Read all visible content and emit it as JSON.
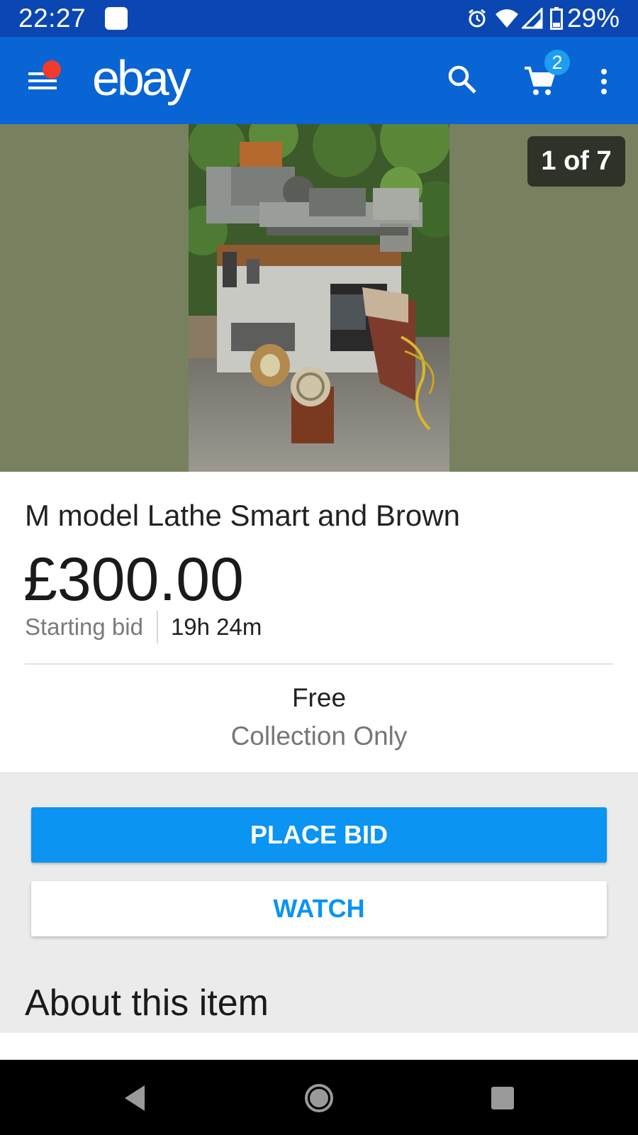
{
  "status_bar": {
    "time": "22:27",
    "battery_percent": "29%",
    "icons": [
      "notification-icon",
      "alarm-icon",
      "wifi-icon",
      "signal-icon",
      "battery-icon"
    ]
  },
  "app_bar": {
    "logo": "ebay",
    "cart_count": "2",
    "menu_has_notification": true,
    "icons": [
      "menu-icon",
      "search-icon",
      "cart-icon",
      "more-vert-icon"
    ]
  },
  "gallery": {
    "counter": "1 of 7",
    "photo": "lathe-photo"
  },
  "listing": {
    "title": "M model Lathe Smart and Brown",
    "price": "£300.00",
    "bid_label": "Starting bid",
    "time_left": "19h 24m",
    "shipping_cost": "Free",
    "shipping_method": "Collection Only"
  },
  "actions": {
    "place_bid": "PLACE BID",
    "watch": "WATCH"
  },
  "about": {
    "heading": "About this item"
  },
  "colors": {
    "status_bar": "#0a47b3",
    "app_bar": "#0964d4",
    "accent": "#0b94f2",
    "badge": "#1c9ef2",
    "notification_dot": "#f03a2e"
  },
  "nav_bar": {
    "icons": [
      "back-icon",
      "home-icon",
      "recents-icon"
    ]
  }
}
